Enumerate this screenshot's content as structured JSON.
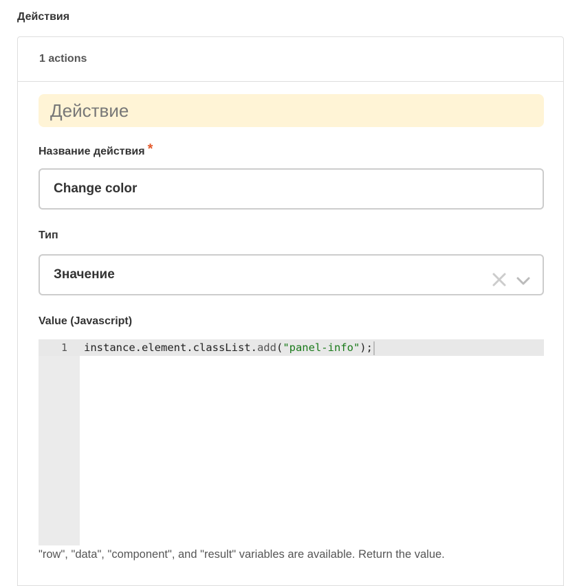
{
  "section": {
    "title": "Действия"
  },
  "panel": {
    "header": "1 actions",
    "banner": "Действие"
  },
  "action_name": {
    "label": "Название действия",
    "required_mark": "*",
    "value": "Change color"
  },
  "type": {
    "label": "Тип",
    "selected": "Значение",
    "icons": {
      "clear": "close-icon",
      "dropdown": "chevron-down-icon"
    }
  },
  "value_js": {
    "label": "Value (Javascript)",
    "line_number": "1",
    "code_prefix": "instance.element.classList.",
    "code_method": "add",
    "code_open": "(",
    "code_string": "\"panel-info\"",
    "code_close": ");"
  },
  "help": {
    "text": "\"row\", \"data\", \"component\", and \"result\" variables are available. Return the value."
  },
  "colors": {
    "banner_bg": "#fff4d6",
    "required": "#e3592b",
    "string": "#1a7a1a",
    "border": "#cccccc"
  }
}
